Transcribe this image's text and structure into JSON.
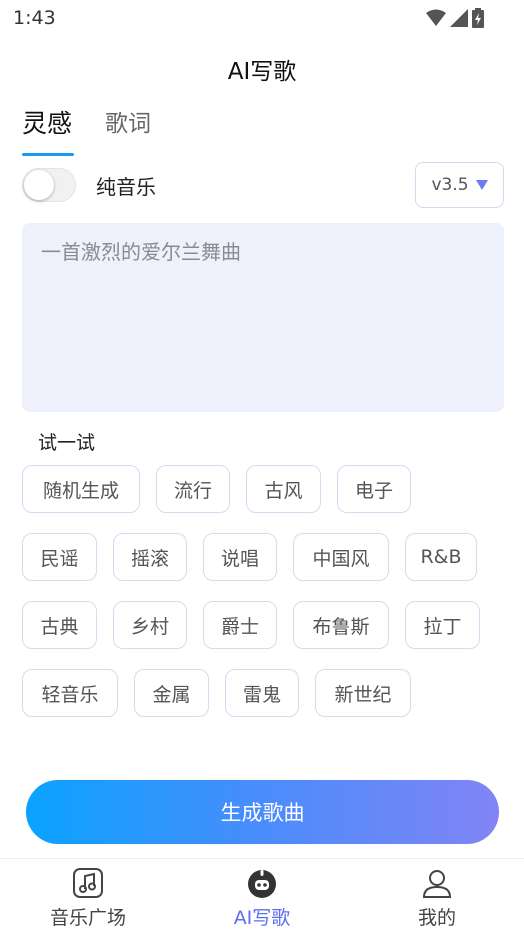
{
  "status": {
    "time": "1:43"
  },
  "header": {
    "title": "AI写歌"
  },
  "tabs": [
    {
      "label": "灵感",
      "active": true
    },
    {
      "label": "歌词",
      "active": false
    }
  ],
  "pure_music": {
    "label": "纯音乐",
    "enabled": false
  },
  "version": {
    "value": "v3.5"
  },
  "prompt": {
    "placeholder": "一首激烈的爱尔兰舞曲",
    "value": ""
  },
  "try_section": {
    "label": "试一试",
    "rows": [
      [
        "随机生成",
        "流行",
        "古风",
        "电子"
      ],
      [
        "民谣",
        "摇滚",
        "说唱",
        "中国风",
        "R&B"
      ],
      [
        "古典",
        "乡村",
        "爵士",
        "布鲁斯",
        "拉丁"
      ],
      [
        "轻音乐",
        "金属",
        "雷鬼",
        "新世纪"
      ]
    ]
  },
  "generate_button": {
    "label": "生成歌曲"
  },
  "bottom_nav": [
    {
      "label": "音乐广场",
      "icon": "music-note-icon",
      "active": false
    },
    {
      "label": "AI写歌",
      "icon": "ai-robot-icon",
      "active": true
    },
    {
      "label": "我的",
      "icon": "profile-icon",
      "active": false
    }
  ],
  "colors": {
    "accent": "#1a9bf0",
    "nav_active": "#5b6fee",
    "prompt_bg": "#eef0fb"
  }
}
